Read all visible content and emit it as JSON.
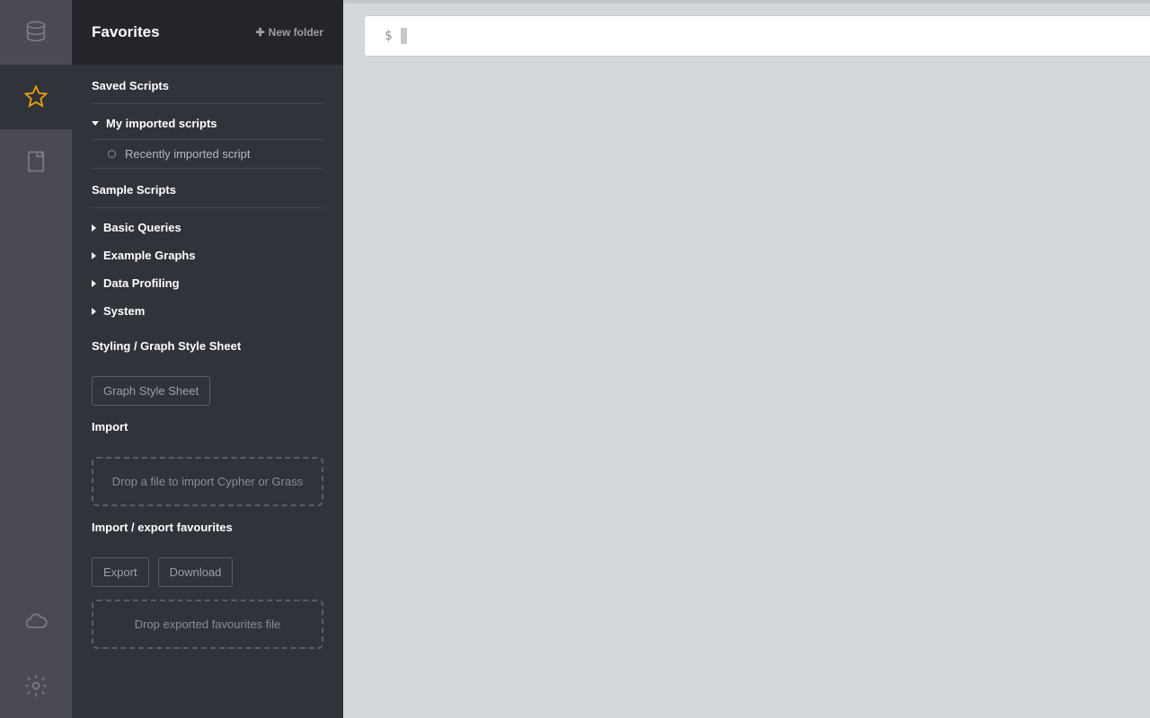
{
  "rail": {
    "items": [
      "database",
      "favorites",
      "documents"
    ],
    "bottom": [
      "cloud",
      "settings"
    ]
  },
  "panel": {
    "title": "Favorites",
    "new_folder_label": "New folder",
    "saved_scripts": {
      "title": "Saved Scripts",
      "folders": [
        {
          "label": "My imported scripts",
          "expanded": true,
          "children": [
            {
              "label": "Recently imported script"
            }
          ]
        }
      ]
    },
    "sample_scripts": {
      "title": "Sample Scripts",
      "folders": [
        {
          "label": "Basic Queries"
        },
        {
          "label": "Example Graphs"
        },
        {
          "label": "Data Profiling"
        },
        {
          "label": "System"
        }
      ]
    },
    "styling": {
      "title": "Styling / Graph Style Sheet",
      "button": "Graph Style Sheet"
    },
    "import": {
      "title": "Import",
      "drop_text": "Drop a file to import Cypher or Grass"
    },
    "import_export": {
      "title": "Import / export favourites",
      "export_btn": "Export",
      "download_btn": "Download",
      "drop_text": "Drop exported favourites file"
    }
  },
  "editor": {
    "prompt": "$"
  }
}
